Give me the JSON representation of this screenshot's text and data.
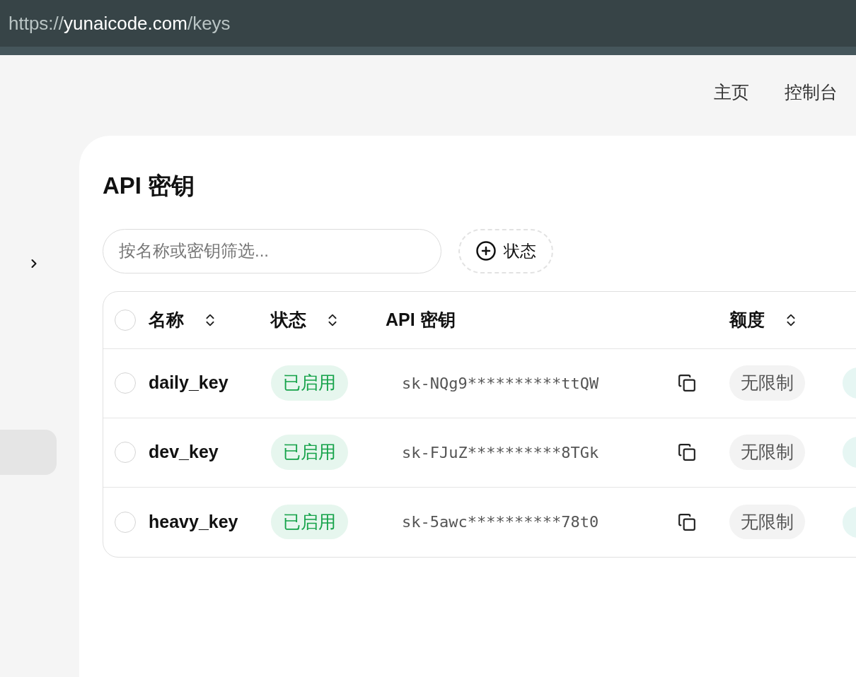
{
  "address_bar": {
    "scheme": "https://",
    "host": "yunaicode.com",
    "path": "/keys"
  },
  "nav": [
    {
      "label": "主页"
    },
    {
      "label": "控制台"
    }
  ],
  "sidebar": {
    "items": [
      {
        "selected": true
      }
    ]
  },
  "page": {
    "title": "API 密钥",
    "filter": {
      "placeholder": "按名称或密钥筛选..."
    },
    "status_filter": {
      "label": "状态"
    },
    "table": {
      "all_selected": false,
      "columns": [
        {
          "label": "名称",
          "sortable": true
        },
        {
          "label": "状态",
          "sortable": true
        },
        {
          "label": "API 密钥",
          "sortable": false
        },
        {
          "label": "额度",
          "sortable": true
        }
      ],
      "rows": [
        {
          "name": "daily_key",
          "selected": false,
          "status": {
            "label": "已启用",
            "kind": "enabled"
          },
          "key": "sk-NQg9**********ttQW",
          "quota": "无限制"
        },
        {
          "name": "dev_key",
          "selected": false,
          "status": {
            "label": "已启用",
            "kind": "enabled"
          },
          "key": "sk-FJuZ**********8TGk",
          "quota": "无限制"
        },
        {
          "name": "heavy_key",
          "selected": false,
          "status": {
            "label": "已启用",
            "kind": "enabled"
          },
          "key": "sk-5awc**********78t0",
          "quota": "无限制"
        }
      ]
    }
  }
}
